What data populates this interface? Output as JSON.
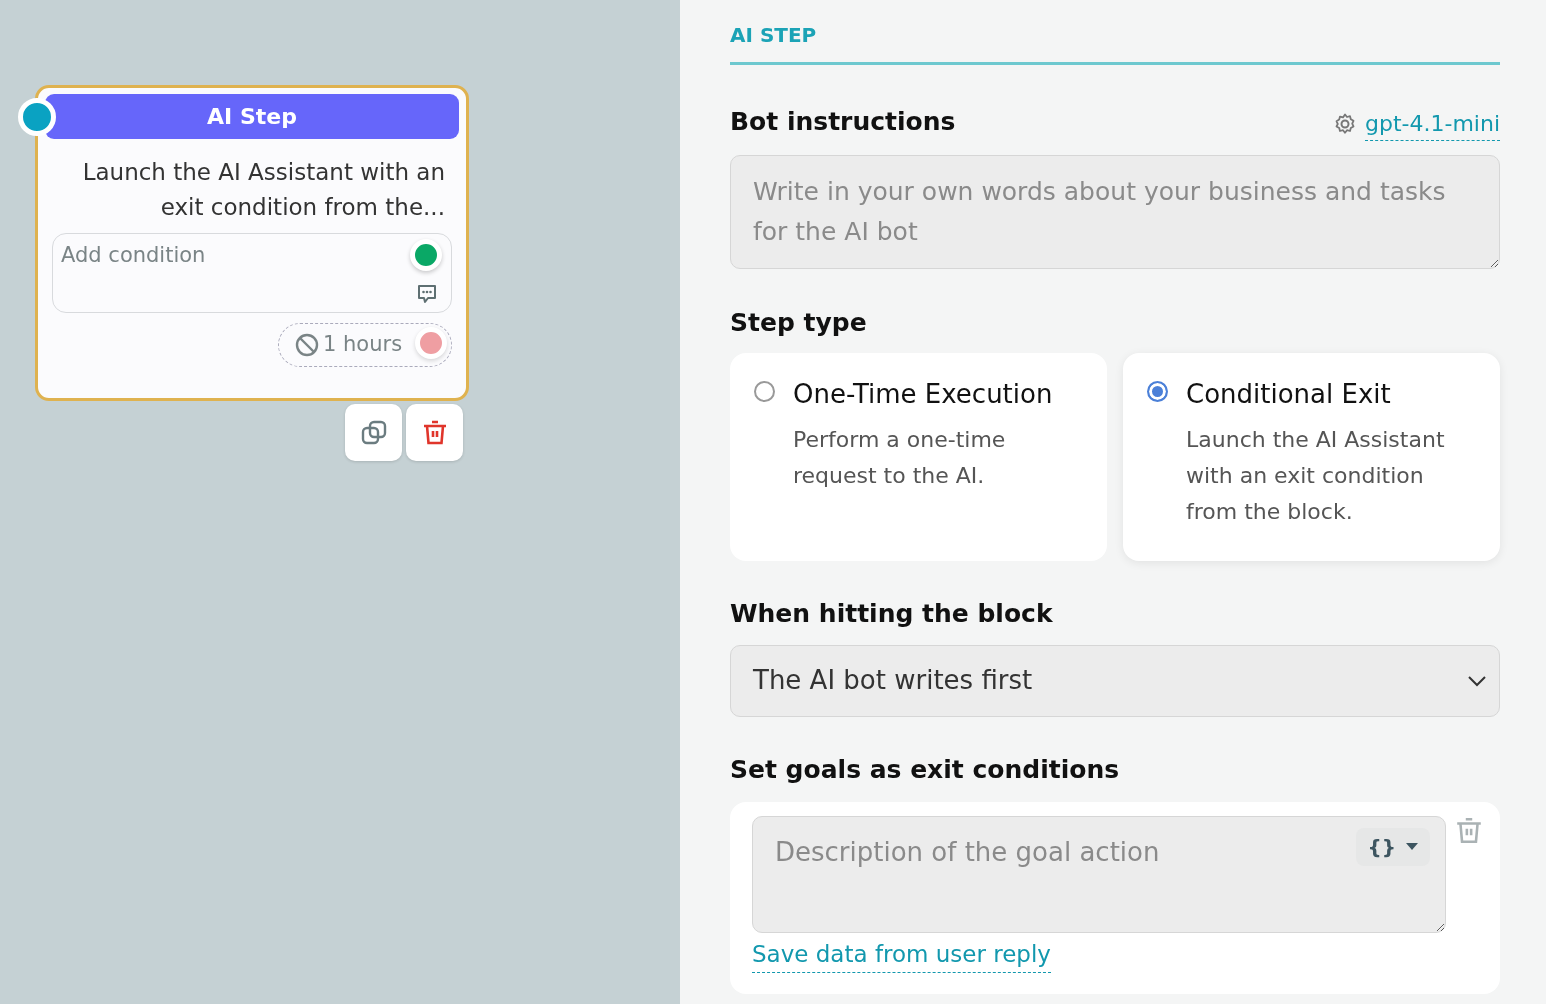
{
  "node": {
    "title": "AI Step",
    "description": "Launch the AI Assistant with an exit condition from the...",
    "condition": {
      "placeholder": "Add condition"
    },
    "timeout": "1 hours"
  },
  "panel": {
    "tab": "AI STEP",
    "instructions": {
      "label": "Bot instructions",
      "model": "gpt-4.1-mini",
      "placeholder": "Write in your own words about your business and tasks for the AI bot"
    },
    "step_type": {
      "label": "Step type",
      "options": [
        {
          "title": "One-Time Execution",
          "description": "Perform a one-time request to the AI.",
          "selected": false
        },
        {
          "title": "Conditional Exit",
          "description": "Launch the AI Assistant with an exit condition from the block.",
          "selected": true
        }
      ]
    },
    "trigger": {
      "label": "When hitting the block",
      "value": "The AI bot writes first"
    },
    "goals": {
      "label": "Set goals as exit conditions",
      "items": [
        {
          "placeholder": "Description of the goal action",
          "variable_button": "{}"
        }
      ],
      "save_link": "Save data from user reply"
    }
  }
}
